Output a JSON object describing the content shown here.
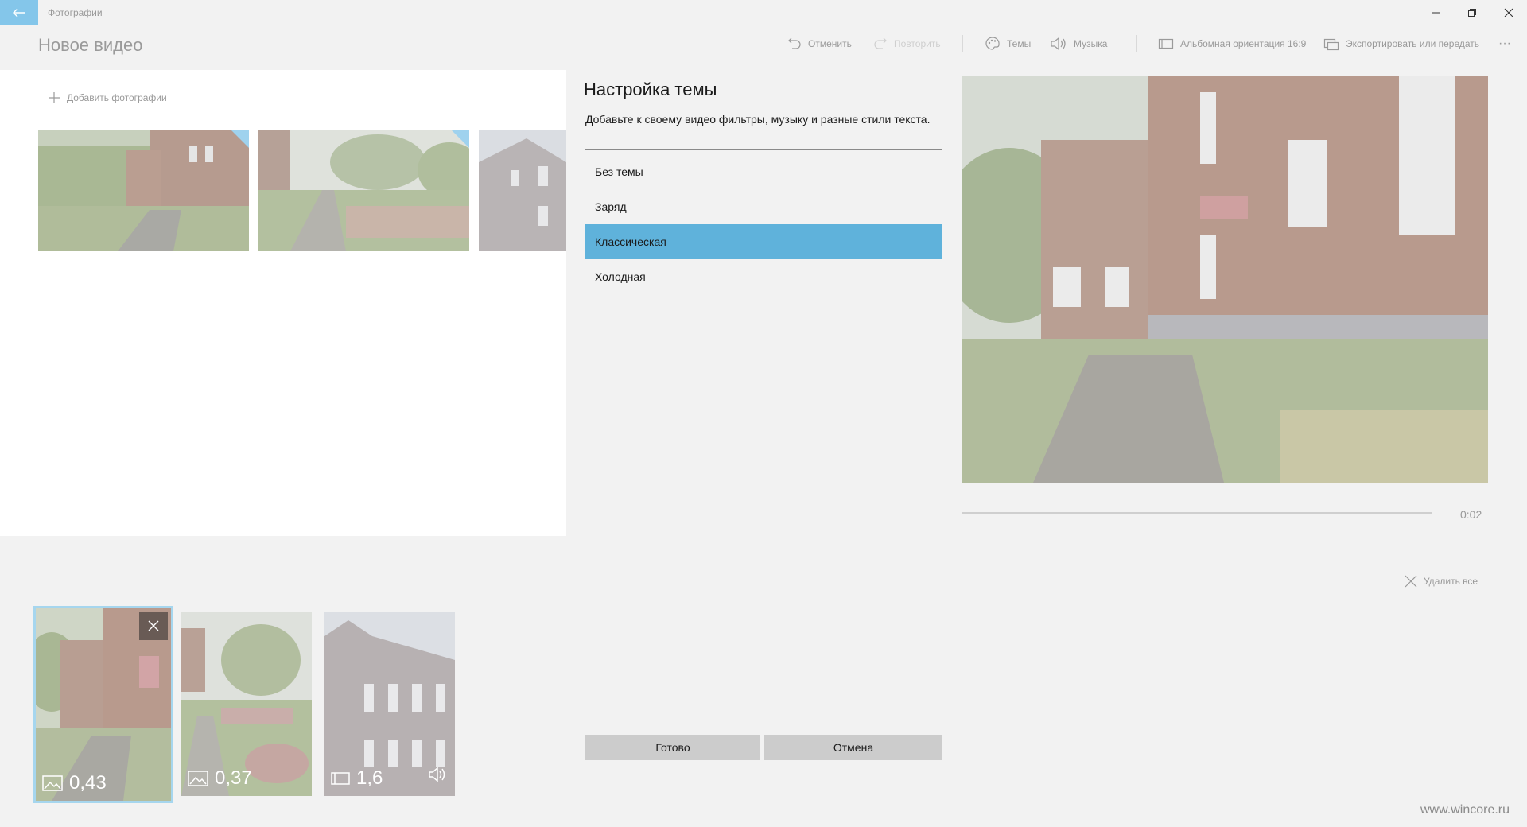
{
  "window": {
    "app_title": "Фотографии",
    "back_icon": "back-arrow-icon",
    "accent": "#84c6ea"
  },
  "header": {
    "title": "Новое видео",
    "toolbar": {
      "undo": "Отменить",
      "redo": "Повторить",
      "themes": "Темы",
      "music": "Музыка",
      "orientation": "Альбомная ориентация 16:9",
      "export": "Экспортировать или передать",
      "more": "···"
    }
  },
  "library": {
    "add_photos": "Добавить фотографии",
    "thumbnails": [
      "school-yard-photo",
      "park-path-photo",
      "building-facade-photo"
    ]
  },
  "preview": {
    "time": "0:02",
    "progress": 0.0
  },
  "storyboard": {
    "delete_all": "Удалить все",
    "cards": [
      {
        "duration": "0,43",
        "kind": "image-icon",
        "selected": true
      },
      {
        "duration": "0,37",
        "kind": "image-icon",
        "selected": false
      },
      {
        "duration": "1,6",
        "kind": "video-icon",
        "selected": false
      }
    ]
  },
  "dialog": {
    "title": "Настройка темы",
    "description": "Добавьте к своему видео фильтры, музыку и разные стили текста.",
    "options": [
      "Без темы",
      "Заряд",
      "Классическая",
      "Холодная"
    ],
    "selected_index": 2,
    "selected_color": "#5fb2db",
    "done": "Готово",
    "cancel": "Отмена"
  },
  "watermark": "www.wincore.ru"
}
